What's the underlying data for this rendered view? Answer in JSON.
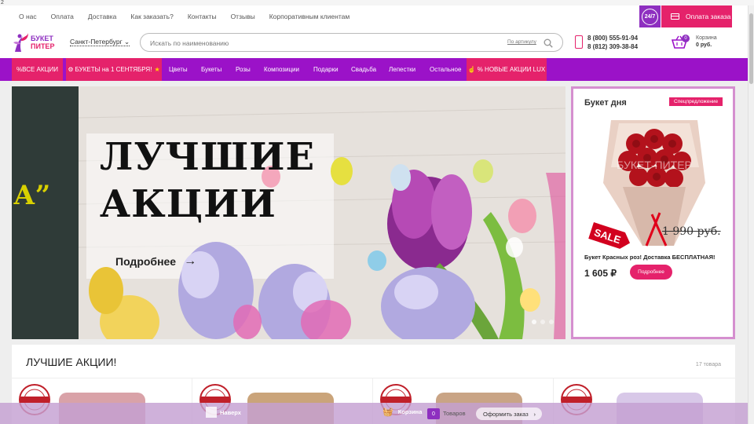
{
  "top_corner": "2",
  "top_nav": {
    "items": [
      "О нас",
      "Оплата",
      "Доставка",
      "Как заказать?",
      "Контакты",
      "Отзывы",
      "Корпоративным клиентам"
    ],
    "badge_247": "24/7",
    "pay_order": "Оплата заказа"
  },
  "header": {
    "logo_line1": "БУКЕТ",
    "logo_line2": "ПИТЕР",
    "city": "Санкт-Петербург",
    "search_placeholder": "Искать по наименованию",
    "by_article": "По артикулу",
    "phone1": "8 (800) 555-91-94",
    "phone2": "8 (812) 309-38-84",
    "cart_count": "0",
    "cart_label": "Корзина",
    "cart_sum": "0 руб."
  },
  "main_nav": {
    "items": [
      "%ВСЕ АКЦИИ",
      "БУКЕТЫ на 1 СЕНТЯБРЯ!",
      "Цветы",
      "Букеты",
      "Розы",
      "Композиции",
      "Подарки",
      "Свадьба",
      "Лепестки",
      "Остальное",
      "% НОВЫЕ АКЦИИ LUX"
    ]
  },
  "hero": {
    "title_line1": "ЛУЧШИЕ",
    "title_line2": "АКЦИИ",
    "more": "Подробнее",
    "arrow": "→",
    "side_text": "А”"
  },
  "bouquet_day": {
    "title": "Букет дня",
    "special": "Спецпредложение",
    "watermark": "БУКЕТ-ПИТЕР",
    "sale": "SALE",
    "old_price": "1 990 руб.",
    "name": "Букет Красных роз! Доставка БЕСПЛАТНАЯ!",
    "price": "1 605 ₽",
    "more": "Подробнее"
  },
  "section": {
    "title": "ЛУЧШИЕ АКЦИИ!",
    "count": "17 товара"
  },
  "bottom_bar": {
    "up": "Наверх",
    "cart": "Корзина",
    "cart_count": "0",
    "goods": "Товаров",
    "checkout": "Оформить заказ"
  },
  "colors": {
    "purple": "#9b12c8",
    "pink": "#e5226b",
    "dark_purple": "#8e2fc0"
  }
}
